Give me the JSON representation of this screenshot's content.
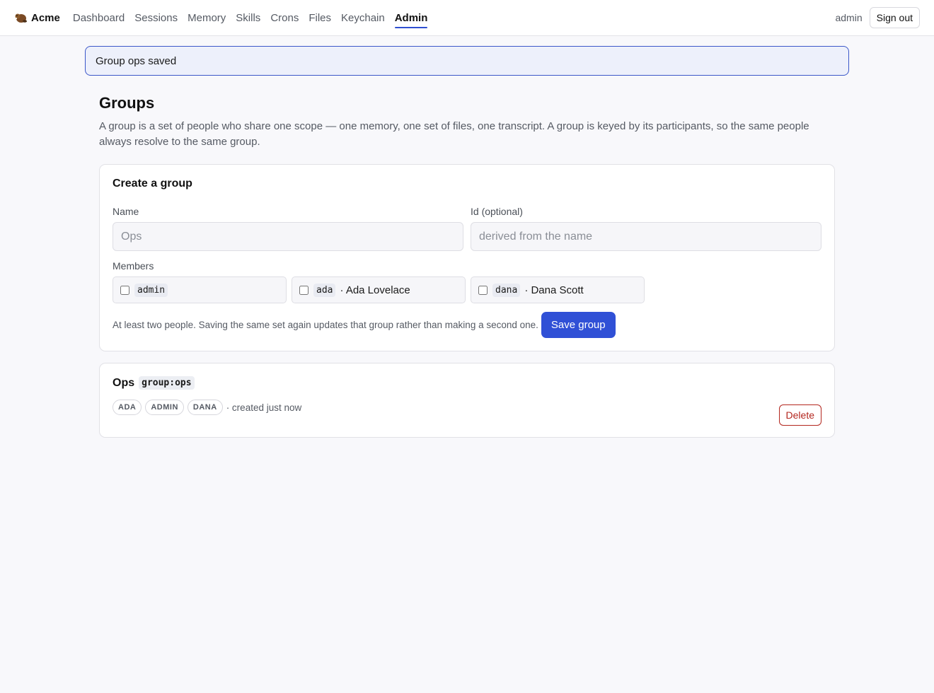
{
  "app": {
    "brand": "Acme",
    "brand_icon": "beaver-logo-icon"
  },
  "nav": {
    "items": [
      {
        "label": "Dashboard",
        "active": false
      },
      {
        "label": "Sessions",
        "active": false
      },
      {
        "label": "Memory",
        "active": false
      },
      {
        "label": "Skills",
        "active": false
      },
      {
        "label": "Crons",
        "active": false
      },
      {
        "label": "Files",
        "active": false
      },
      {
        "label": "Keychain",
        "active": false
      },
      {
        "label": "Admin",
        "active": true
      }
    ],
    "user": "admin",
    "sign_out_label": "Sign out"
  },
  "flash": {
    "message": "Group ops saved"
  },
  "page": {
    "title": "Groups",
    "description": "A group is a set of people who share one scope — one memory, one set of files, one transcript. A group is keyed by its participants, so the same people always resolve to the same group."
  },
  "create_form": {
    "title": "Create a group",
    "name_label": "Name",
    "name_placeholder": "Ops",
    "id_label": "Id (optional)",
    "id_placeholder": "derived from the name",
    "members_label": "Members",
    "members": [
      {
        "id": "admin",
        "name": "",
        "checked": false
      },
      {
        "id": "ada",
        "name": "· Ada Lovelace",
        "checked": false
      },
      {
        "id": "dana",
        "name": "· Dana Scott",
        "checked": false
      }
    ],
    "hint": "At least two people. Saving the same set again updates that group rather than making a second one.",
    "save_label": "Save group"
  },
  "groups": [
    {
      "name": "Ops",
      "id": "group:ops",
      "members": [
        "ADA",
        "ADMIN",
        "DANA"
      ],
      "created": "· created just now",
      "delete_label": "Delete"
    }
  ],
  "colors": {
    "accent": "#3050d6",
    "danger": "#b3261e",
    "flash_bg": "#edf0fb",
    "flash_border": "#3b57c9"
  }
}
